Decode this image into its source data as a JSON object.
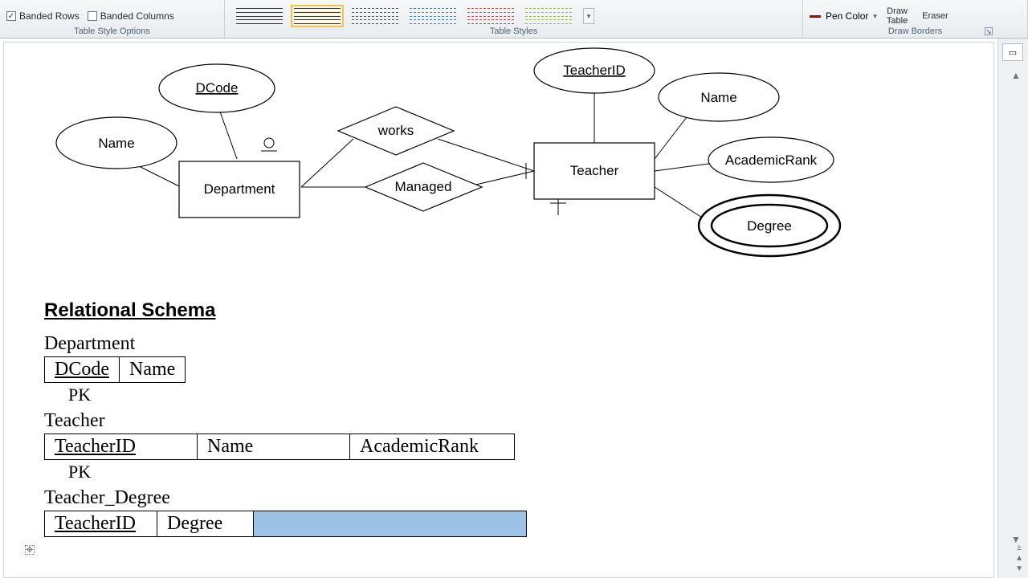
{
  "ribbon": {
    "banded_rows": "Banded Rows",
    "banded_cols": "Banded Columns",
    "group_options": "Table Style Options",
    "group_styles": "Table Styles",
    "group_borders": "Draw Borders",
    "pen_color": "Pen Color",
    "draw_table_1": "Draw",
    "draw_table_2": "Table",
    "eraser": "Eraser"
  },
  "er": {
    "dcode": "DCode",
    "name1": "Name",
    "department": "Department",
    "works": "works",
    "managed": "Managed",
    "teacher": "Teacher",
    "teacherid": "TeacherID",
    "name2": "Name",
    "academicrank": "AcademicRank",
    "degree": "Degree"
  },
  "schema": {
    "title": "Relational Schema",
    "t1_name": "Department",
    "t1_c1": "DCode",
    "t1_c2": "Name",
    "pk": "PK",
    "t2_name": "Teacher",
    "t2_c1": "TeacherID",
    "t2_c2": "Name",
    "t2_c3": "AcademicRank",
    "t3_name": "Teacher_Degree",
    "t3_c1": "TeacherID",
    "t3_c2": "Degree"
  }
}
